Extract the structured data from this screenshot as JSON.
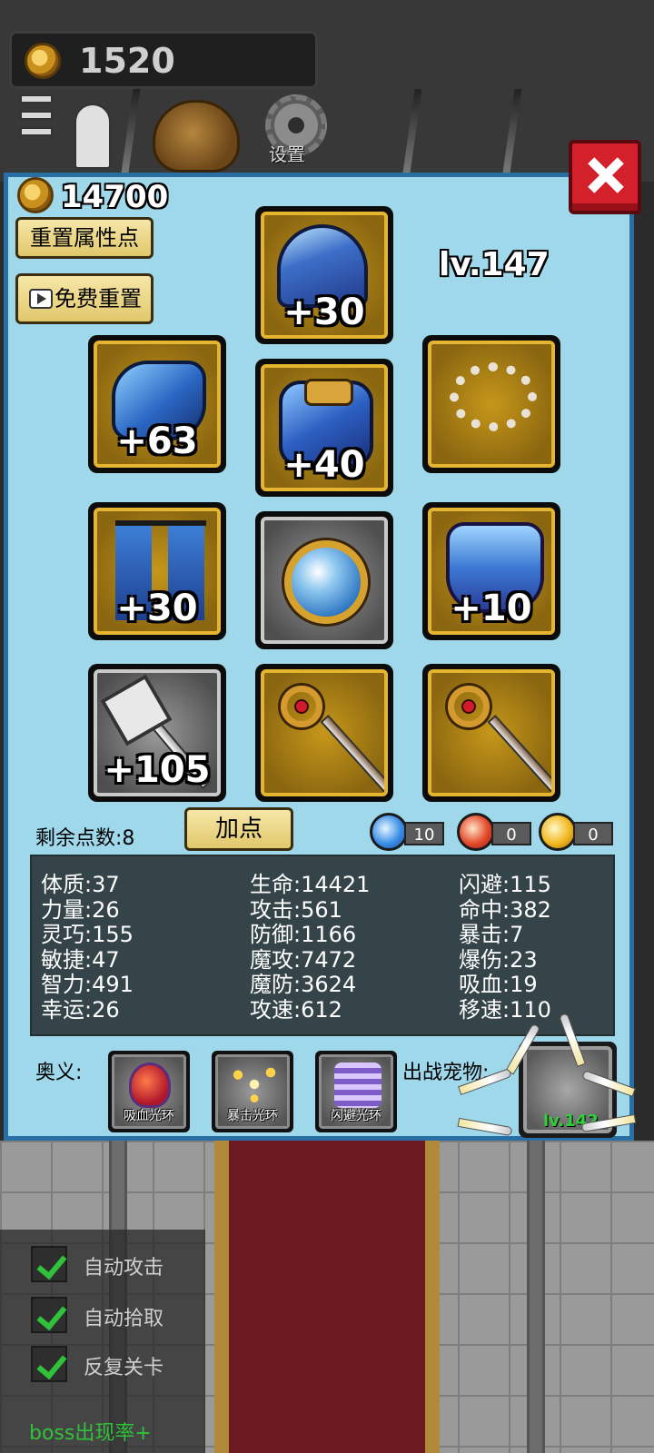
{
  "top_bar": {
    "gold": "1520",
    "tabs": [
      {
        "id": "menu",
        "icon": "menu-list-icon"
      },
      {
        "id": "bag",
        "icon": "bag-icon"
      },
      {
        "id": "settings",
        "icon": "gear-icon",
        "label": "设置"
      }
    ]
  },
  "panel": {
    "gold": "14700",
    "reset_points_label": "重置属性点",
    "free_reset_label": "免费重置",
    "level": "lv.147",
    "equipment": [
      {
        "slot": "helmet",
        "enhance": "+30"
      },
      {
        "slot": "gloves",
        "enhance": "+63"
      },
      {
        "slot": "armor",
        "enhance": "+40"
      },
      {
        "slot": "necklace",
        "enhance": ""
      },
      {
        "slot": "boots",
        "enhance": "+30"
      },
      {
        "slot": "orb",
        "enhance": ""
      },
      {
        "slot": "pants",
        "enhance": "+10"
      },
      {
        "slot": "mace",
        "enhance": "+105"
      },
      {
        "slot": "staff-1",
        "enhance": ""
      },
      {
        "slot": "staff-2",
        "enhance": ""
      }
    ],
    "remaining_points": "剩余点数:8",
    "add_point_label": "加点",
    "gems": {
      "water": "10",
      "fire": "0",
      "thunder": "0"
    },
    "stats": {
      "col1": [
        "体质:37",
        "力量:26",
        "灵巧:155",
        "敏捷:47",
        "智力:491",
        "幸运:26"
      ],
      "col2": [
        "生命:14421",
        "攻击:561",
        "防御:1166",
        "魔攻:7472",
        "魔防:3624",
        "攻速:612"
      ],
      "col3": [
        "闪避:115",
        "命中:382",
        "暴击:7",
        "爆伤:23",
        "吸血:19",
        "移速:110"
      ]
    },
    "skills_label": "奥义:",
    "skills": [
      "吸血光环",
      "暴击光环",
      "闪避光环"
    ],
    "pet_label": "出战宠物:",
    "pet_level": "lv.142"
  },
  "options": {
    "auto_attack": "自动攻击",
    "auto_pickup": "自动拾取",
    "repeat_level": "反复关卡",
    "boss_rate": "boss出现率+"
  },
  "colors": {
    "panel_bg": "#9ed8ea",
    "panel_border": "#2a6fa4",
    "slot_gold": "#e6b52f",
    "close_red": "#d4202a",
    "check_green": "#2fc23a"
  }
}
